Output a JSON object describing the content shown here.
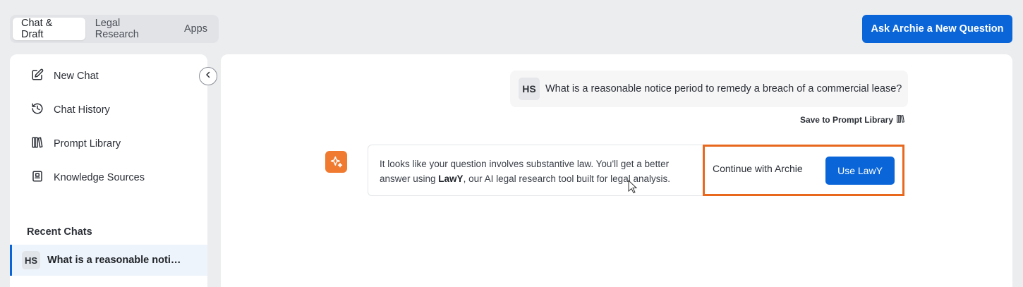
{
  "tabs": [
    {
      "label": "Chat & Draft",
      "active": true
    },
    {
      "label": "Legal Research",
      "active": false
    },
    {
      "label": "Apps",
      "active": false
    }
  ],
  "header": {
    "ask_button": "Ask Archie a New Question"
  },
  "sidebar": {
    "items": [
      {
        "label": "New Chat",
        "icon": "edit-icon"
      },
      {
        "label": "Chat History",
        "icon": "history-icon"
      },
      {
        "label": "Prompt Library",
        "icon": "library-icon"
      },
      {
        "label": "Knowledge Sources",
        "icon": "book-icon"
      }
    ],
    "recent_title": "Recent Chats",
    "recent_chats": [
      {
        "initials": "HS",
        "title": "What is a reasonable notic..."
      }
    ]
  },
  "conversation": {
    "user_initials": "HS",
    "user_message": "What is a reasonable notice period to remedy a breach of a commercial lease?",
    "save_prompt": "Save to Prompt Library",
    "bot_message_part1": "It looks like your question involves substantive law. You'll get a better answer using ",
    "bot_message_bold": "LawY",
    "bot_message_part2": ", our AI legal research tool built for legal analysis.",
    "continue_label": "Continue with Archie",
    "lawy_label": "Use LawY"
  },
  "colors": {
    "accent": "#0a66d8",
    "highlight": "#e8681e",
    "bot_icon": "#f07a30"
  }
}
